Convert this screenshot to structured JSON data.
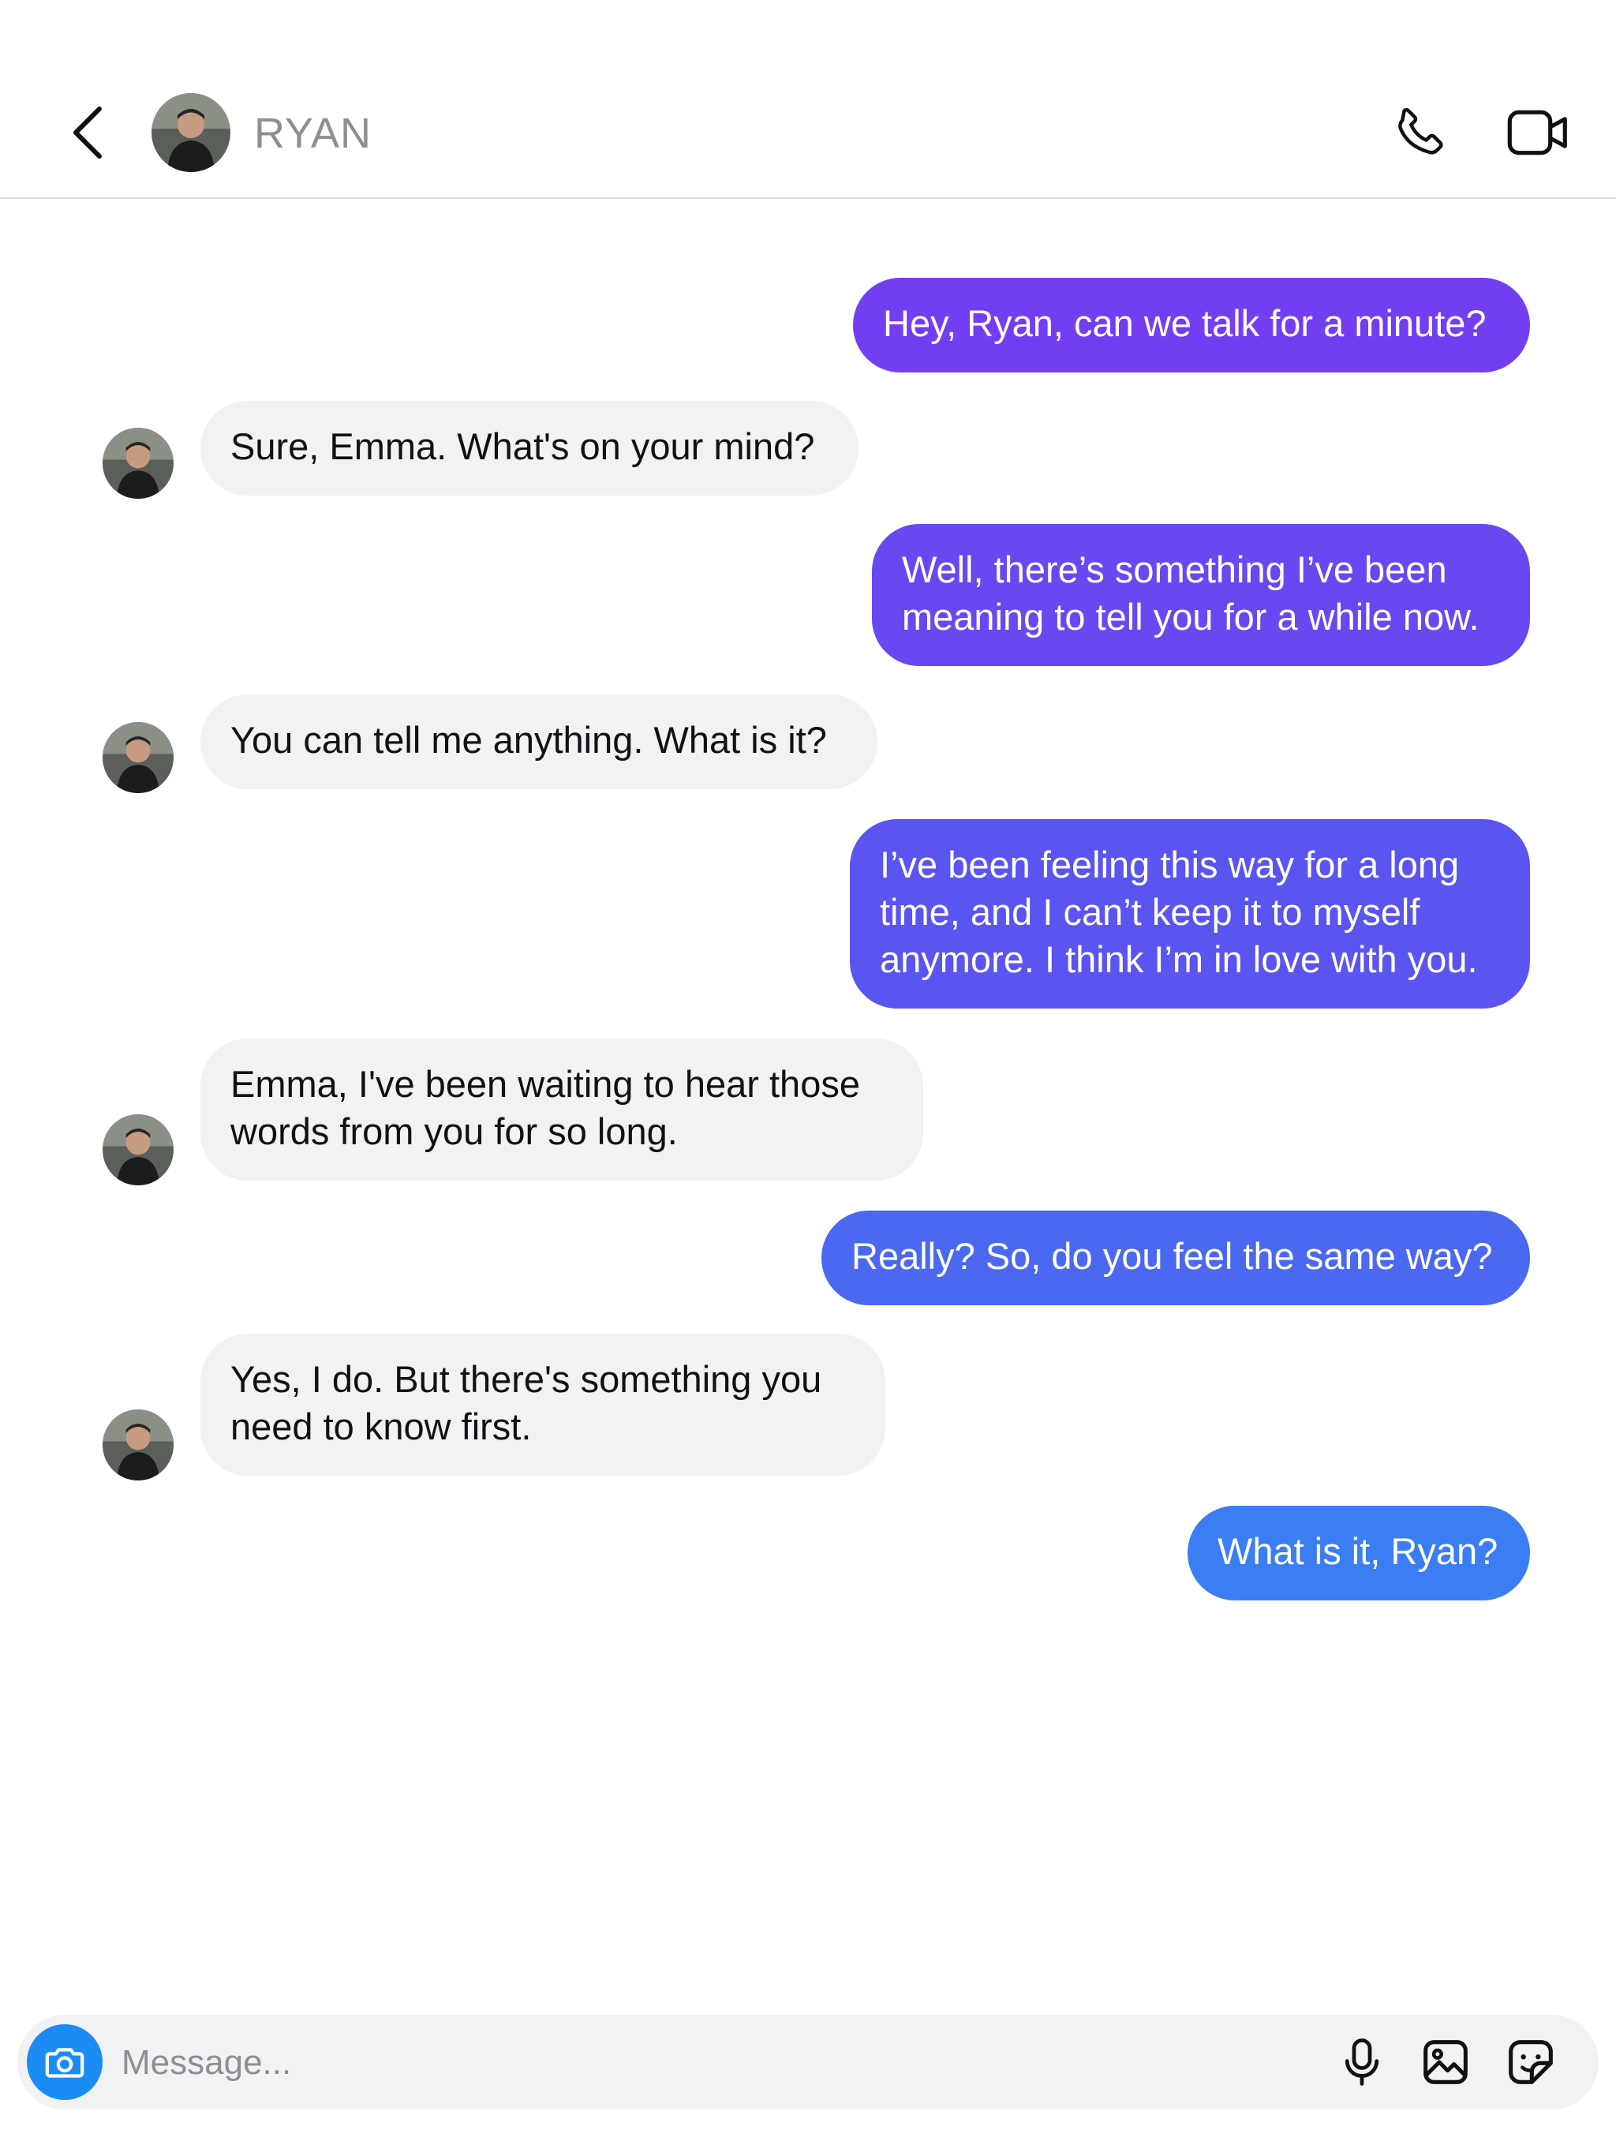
{
  "header": {
    "contact_name": "RYAN",
    "icons": {
      "back": "chevron-left-icon",
      "call": "phone-icon",
      "video": "video-camera-icon"
    }
  },
  "colors": {
    "outgoing_top": "#7b3cf2",
    "outgoing_mid": "#5b54f0",
    "outgoing_bottom": "#3a7ef2",
    "incoming_bg": "#f1f2f4",
    "accent_blue": "#1c8cf5",
    "name_gray": "#8e8e93"
  },
  "messages": [
    {
      "direction": "out",
      "text": "Hey, Ryan, can we talk for a minute?"
    },
    {
      "direction": "in",
      "text": "Sure, Emma. What's on your mind?"
    },
    {
      "direction": "out",
      "text": "Well, there’s something I’ve been meaning to tell you for a while now."
    },
    {
      "direction": "in",
      "text": "You can tell me anything. What is it?"
    },
    {
      "direction": "out",
      "text": "I’ve been feeling this way for a long time, and I can’t keep it to myself anymore. I think I’m in love with you."
    },
    {
      "direction": "in",
      "text": "Emma, I've been waiting to hear those words from you for so long."
    },
    {
      "direction": "out",
      "text": "Really? So, do you feel the same way?"
    },
    {
      "direction": "in",
      "text": "Yes, I do. But there's something you need to know first."
    },
    {
      "direction": "out",
      "text": "What is it, Ryan?"
    }
  ],
  "composer": {
    "placeholder": "Message...",
    "icons": {
      "camera": "camera-icon",
      "microphone": "microphone-icon",
      "gallery": "image-gallery-icon",
      "sticker": "sticker-icon"
    }
  }
}
